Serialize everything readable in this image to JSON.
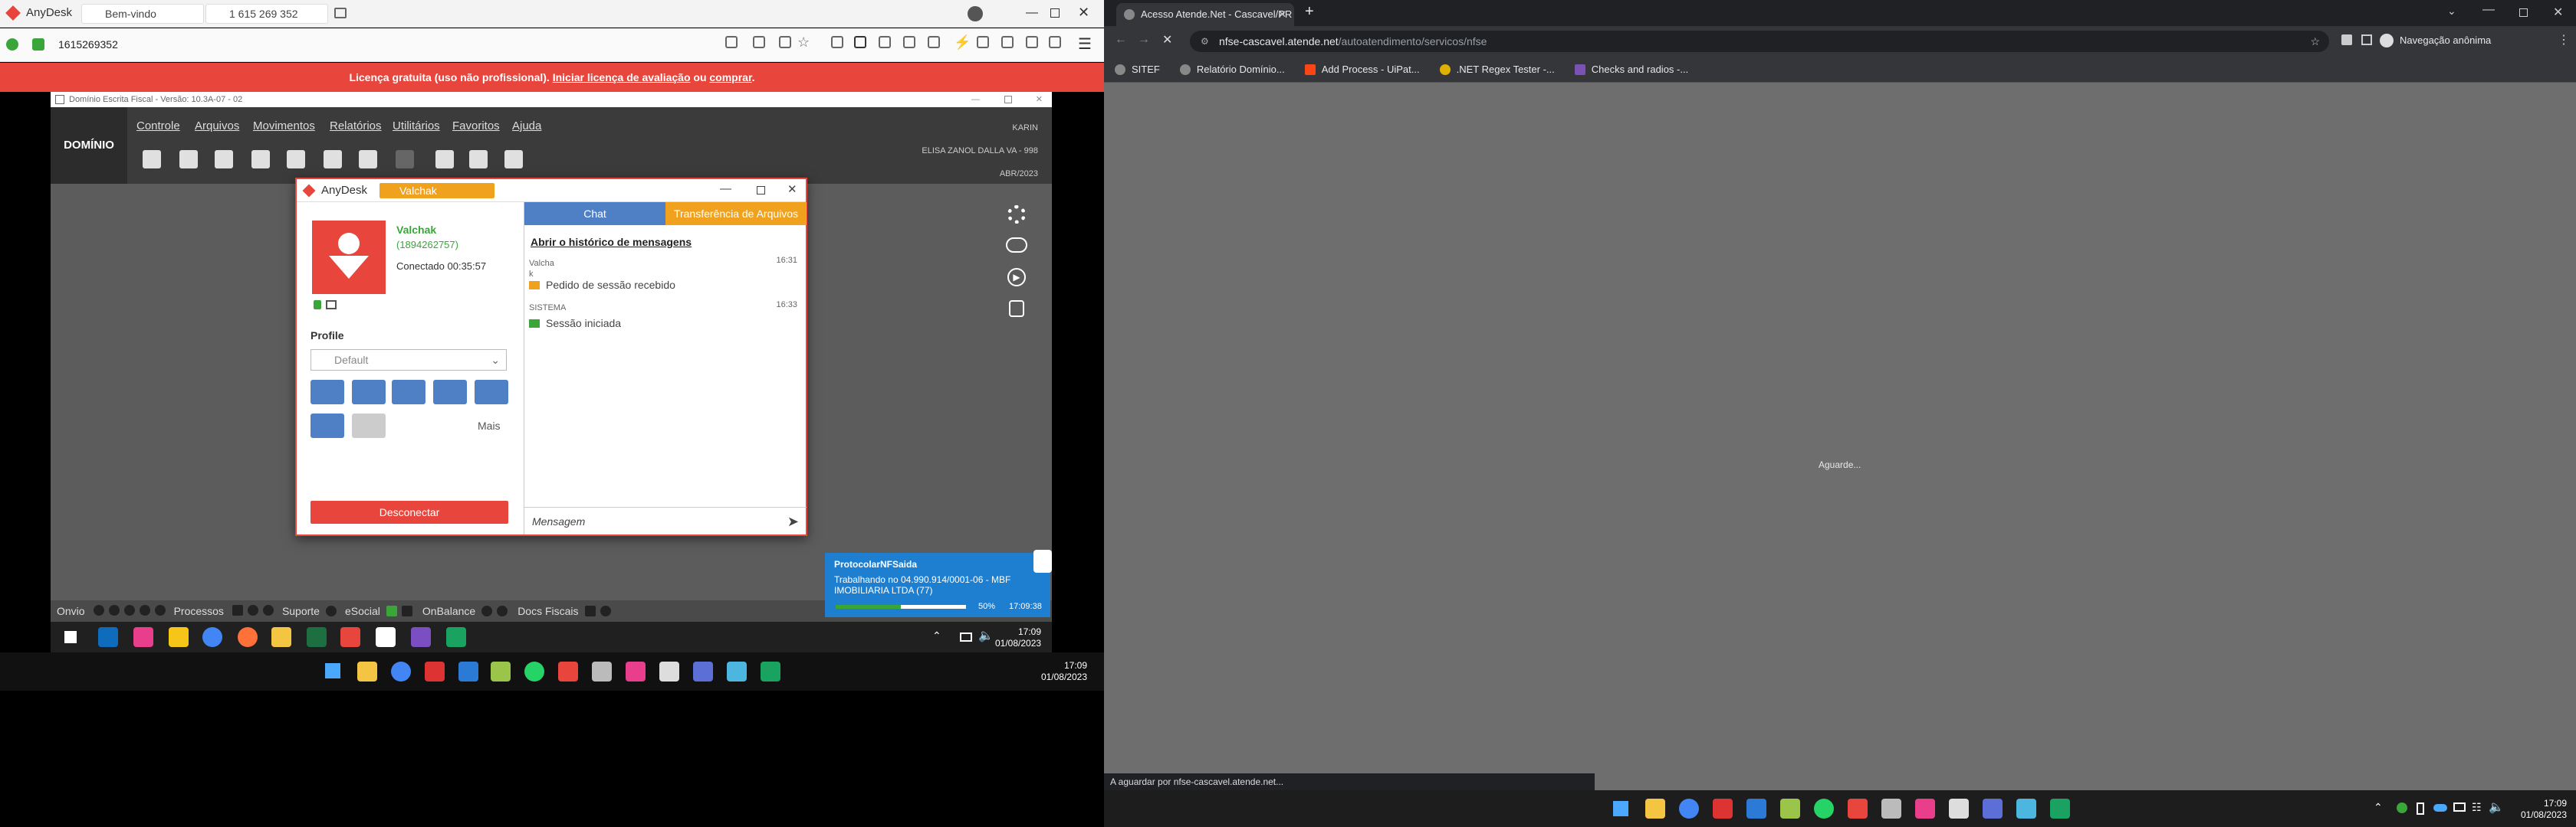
{
  "left": {
    "anydesk_title": "AnyDesk",
    "tab_welcome": "Bem-vindo",
    "tab_remote": "1 615 269 352",
    "address_id": "1615269352",
    "license_text": "Licença gratuita (uso não profissional).",
    "license_link1": "Iniciar licença de avaliação",
    "license_or": "ou",
    "license_link2": "comprar",
    "license_end": ".",
    "remote": {
      "window_title": "Domínio Escrita Fiscal - Versão: 10.3A-07 - 02",
      "logo": "DOMÍNIO",
      "menu": [
        "Controle",
        "Arquivos",
        "Movimentos",
        "Relatórios",
        "Utilitários",
        "Favoritos",
        "Ajuda"
      ],
      "user": "KARIN",
      "company": "ELISA ZANOL DALLA VA - 998",
      "period": "ABR/2023",
      "status": {
        "onvio": "Onvio",
        "processos": "Processos",
        "suporte": "Suporte",
        "esocial": "eSocial",
        "onbalance": "OnBalance",
        "docs": "Docs Fiscais"
      },
      "tray_time": "17:09",
      "tray_date": "01/08/2023"
    },
    "dialog": {
      "title": "AnyDesk",
      "tab": "Valchak",
      "name": "Valchak",
      "id": "(1894262757)",
      "connected": "Conectado 00:35:57",
      "profile_label": "Profile",
      "profile_value": "Default",
      "more": "Mais",
      "disconnect": "Desconectar",
      "tab_chat": "Chat",
      "tab_files": "Transferência de Arquivos",
      "history_link": "Abrir o histórico de mensagens",
      "msg1_from": "Valcha",
      "msg1_sub": "k",
      "msg1_time": "16:31",
      "msg1_text": "Pedido de sessão recebido",
      "msg2_from": "SISTEMA",
      "msg2_time": "16:33",
      "msg2_text": "Sessão iniciada",
      "input_placeholder": "Mensagem"
    },
    "notification": {
      "title": "ProtocolarNFSaida",
      "line1": "Trabalhando no 04.990.914/0001-06 - MBF",
      "line2": "IMOBILIARIA LTDA (77)",
      "progress_pct": "50%",
      "progress": 0.5,
      "time": "17:09:38"
    },
    "clock_time": "17:09",
    "clock_date": "01/08/2023"
  },
  "right": {
    "tab_title": "Acesso Atende.Net - Cascavel/PR",
    "url_host": "nfse-cascavel.atende.net",
    "url_path": "/autoatendimento/servicos/nfse",
    "incognito": "Navegação anônima",
    "bookmarks": [
      "SITEF",
      "Relatório Domínio...",
      "Add Process - UiPat...",
      ".NET Regex Tester -...",
      "Checks and radios -..."
    ],
    "waiting": "Aguarde...",
    "status_text": "A aguardar por nfse-cascavel.atende.net...",
    "clock_time": "17:09",
    "clock_date": "01/08/2023"
  }
}
